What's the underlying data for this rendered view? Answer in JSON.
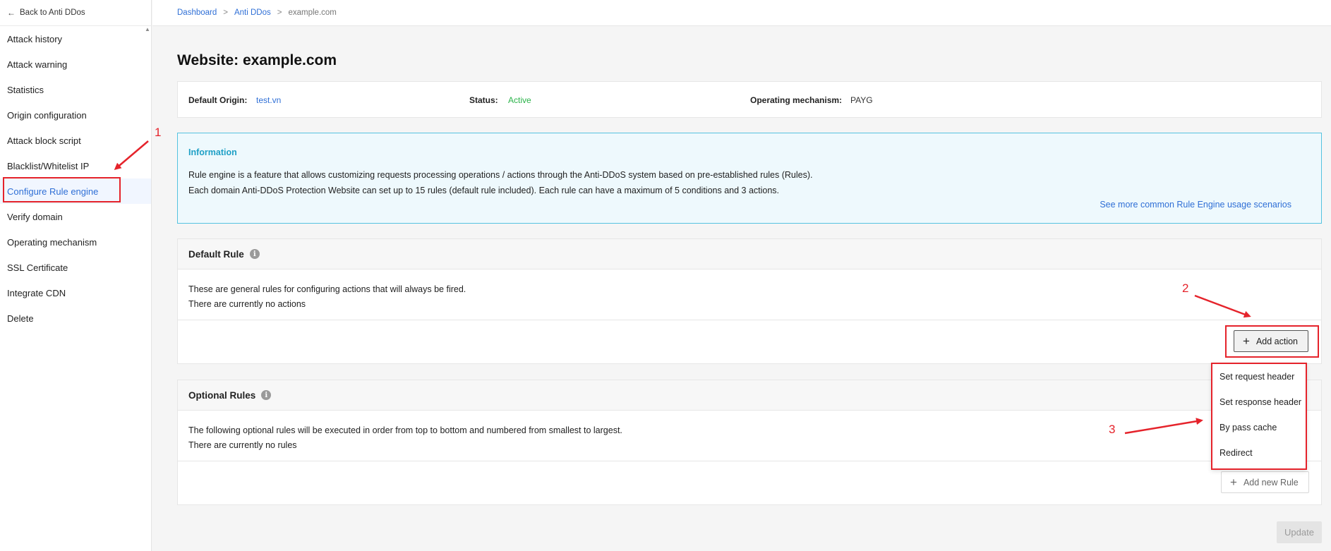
{
  "sidebar": {
    "back_label": "Back to Anti DDos",
    "items": [
      {
        "label": "Attack history"
      },
      {
        "label": "Attack warning"
      },
      {
        "label": "Statistics"
      },
      {
        "label": "Origin configuration"
      },
      {
        "label": "Attack block script"
      },
      {
        "label": "Blacklist/Whitelist IP"
      },
      {
        "label": "Configure Rule engine"
      },
      {
        "label": "Verify domain"
      },
      {
        "label": "Operating mechanism"
      },
      {
        "label": "SSL Certificate"
      },
      {
        "label": "Integrate CDN"
      },
      {
        "label": "Delete"
      }
    ],
    "active_item": "Configure Rule engine"
  },
  "breadcrumb": {
    "items": [
      "Dashboard",
      "Anti DDos"
    ],
    "separator": ">",
    "current": "example.com"
  },
  "page": {
    "title": "Website: example.com"
  },
  "origin_bar": {
    "default_origin_label": "Default Origin:",
    "default_origin_value": "test.vn",
    "status_label": "Status:",
    "status_value": "Active",
    "operating_label": "Operating mechanism:",
    "operating_value": "PAYG"
  },
  "info_box": {
    "title": "Information",
    "line1": "Rule engine is a feature that allows customizing requests processing operations / actions through the Anti-DDoS system based on pre-established rules (Rules).",
    "line2": "Each domain Anti-DDoS Protection Website can set up to 15 rules (default rule included). Each rule can have a maximum of 5 conditions and 3 actions.",
    "link": "See more common Rule Engine usage scenarios"
  },
  "default_rule": {
    "title": "Default Rule",
    "desc": "These are general rules for configuring actions that will always be fired.",
    "status": "There are currently no actions",
    "add_button": "Add action"
  },
  "action_menu": {
    "options": [
      "Set request header",
      "Set response header",
      "By pass cache",
      "Redirect"
    ]
  },
  "optional_rules": {
    "title": "Optional Rules",
    "desc": "The following optional rules will be executed in order from top to bottom and numbered from smallest to largest.",
    "status": "There are currently no rules",
    "add_button": "Add new Rule"
  },
  "update_button": "Update",
  "annotations": [
    "1",
    "2",
    "3"
  ],
  "colors": {
    "link_blue": "#2f6fd6",
    "status_green": "#2bb34a",
    "info_cyan": "#1fa0c6",
    "annotation_red": "#e5232b"
  }
}
